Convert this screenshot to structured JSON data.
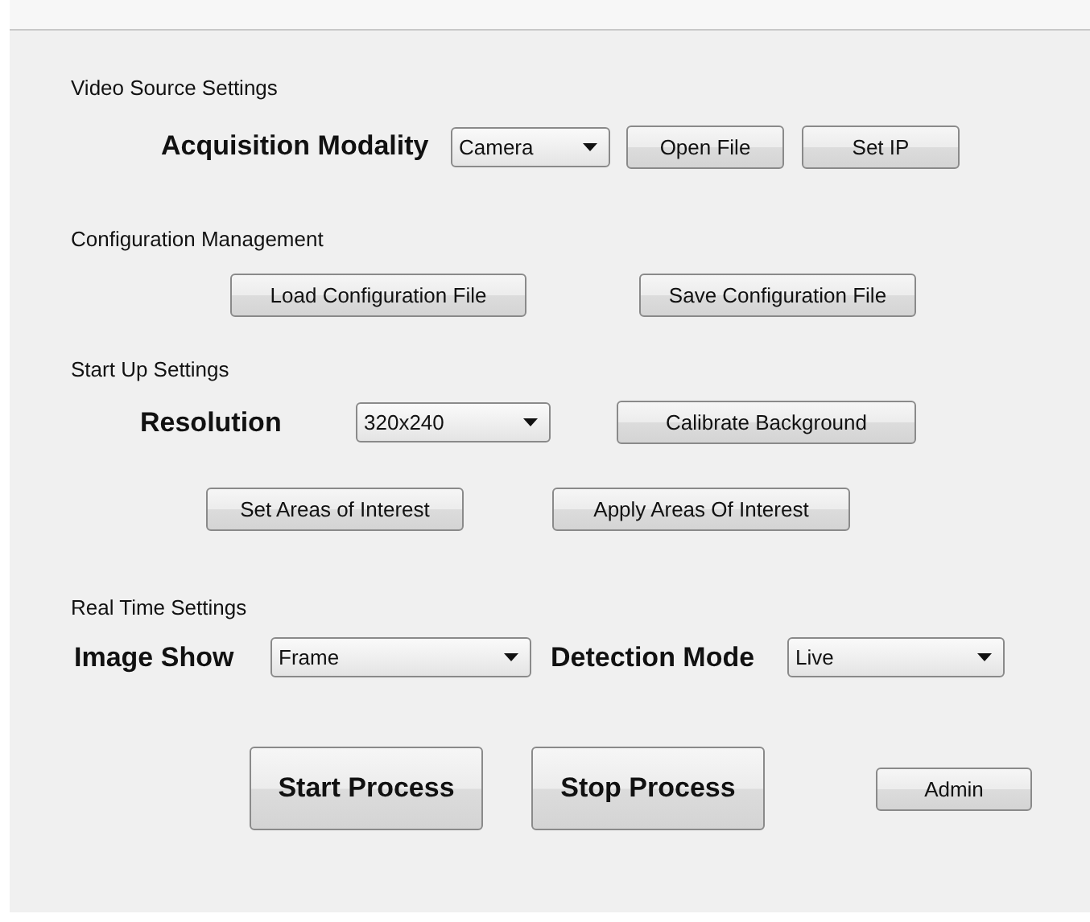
{
  "sections": [
    {
      "title": "Video Source Settings",
      "lines": [
        {
          "items": [
            {
              "kind": "label",
              "text": "Acquisition Modality"
            },
            {
              "kind": "dropdown",
              "value": "Camera"
            },
            {
              "kind": "button",
              "text": "Open File"
            },
            {
              "kind": "button",
              "text": "Set IP"
            }
          ]
        }
      ]
    },
    {
      "title": "Configuration Management",
      "lines": [
        {
          "items": [
            {
              "kind": "button",
              "text": "Load Configuration File"
            },
            {
              "kind": "button",
              "text": "Save Configuration File"
            }
          ]
        }
      ]
    },
    {
      "title": "Start Up Settings",
      "lines": [
        {
          "items": [
            {
              "kind": "label",
              "text": "Resolution"
            },
            {
              "kind": "dropdown",
              "value": "320x240"
            },
            {
              "kind": "button",
              "text": "Calibrate Background"
            }
          ]
        },
        {
          "items": [
            {
              "kind": "button",
              "text": "Set Areas of Interest"
            },
            {
              "kind": "button",
              "text": "Apply Areas Of Interest"
            }
          ]
        }
      ]
    },
    {
      "title": "Real Time Settings",
      "lines": [
        {
          "items": [
            {
              "kind": "label",
              "text": "Image Show"
            },
            {
              "kind": "dropdown",
              "value": "Frame"
            },
            {
              "kind": "label",
              "text": "Detection Mode"
            },
            {
              "kind": "dropdown",
              "value": "Live"
            }
          ]
        }
      ]
    }
  ],
  "actions": [
    {
      "kind": "big",
      "text": "Start Process"
    },
    {
      "kind": "big",
      "text": "Stop Process"
    },
    {
      "kind": "button",
      "text": "Admin"
    }
  ]
}
